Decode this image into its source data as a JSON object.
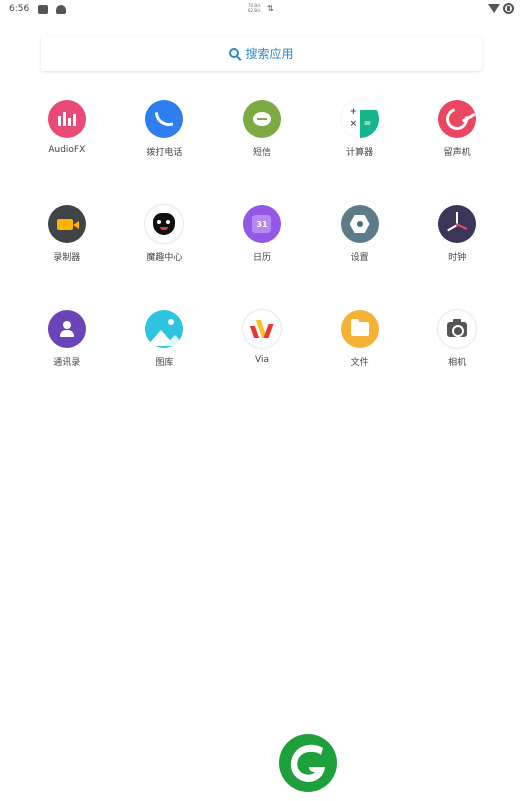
{
  "status_bar": {
    "time": "6:56",
    "net_up": "70 B/s",
    "net_down": "62 B/s",
    "icons": [
      "notification-icon",
      "android-icon",
      "data-arrows-icon",
      "wifi-icon",
      "battery-icon"
    ]
  },
  "search": {
    "label": "搜索应用",
    "icon": "search-icon",
    "accent": "#2f86d0"
  },
  "apps": [
    {
      "label": "AudioFX",
      "icon": "audiofx-icon",
      "color": "#e84a75"
    },
    {
      "label": "拨打电话",
      "icon": "phone-icon",
      "color": "#2f7ef0"
    },
    {
      "label": "短信",
      "icon": "message-icon",
      "color": "#7cab44"
    },
    {
      "label": "计算器",
      "icon": "calculator-icon",
      "color": "#16b48b"
    },
    {
      "label": "留声机",
      "icon": "recorder-player-icon",
      "color": "#ec4760"
    },
    {
      "label": "录制器",
      "icon": "video-recorder-icon",
      "color": "#3f4447"
    },
    {
      "label": "魔趣中心",
      "icon": "mokee-monster-icon",
      "color": "#ffffff"
    },
    {
      "label": "日历",
      "icon": "calendar-icon",
      "color": "#9457e6",
      "day": "31"
    },
    {
      "label": "设置",
      "icon": "settings-icon",
      "color": "#5c7a88"
    },
    {
      "label": "时钟",
      "icon": "clock-icon",
      "color": "#3a3559"
    },
    {
      "label": "通讯录",
      "icon": "contacts-icon",
      "color": "#6a45b8"
    },
    {
      "label": "图库",
      "icon": "gallery-icon",
      "color": "#2ec4e0"
    },
    {
      "label": "Via",
      "icon": "via-browser-icon",
      "color": "#ffffff"
    },
    {
      "label": "文件",
      "icon": "folder-icon",
      "color": "#f5b335"
    },
    {
      "label": "相机",
      "icon": "camera-icon",
      "color": "#ffffff"
    }
  ],
  "brand": {
    "icon": "brand-logo-icon",
    "color": "#1ea03a"
  }
}
